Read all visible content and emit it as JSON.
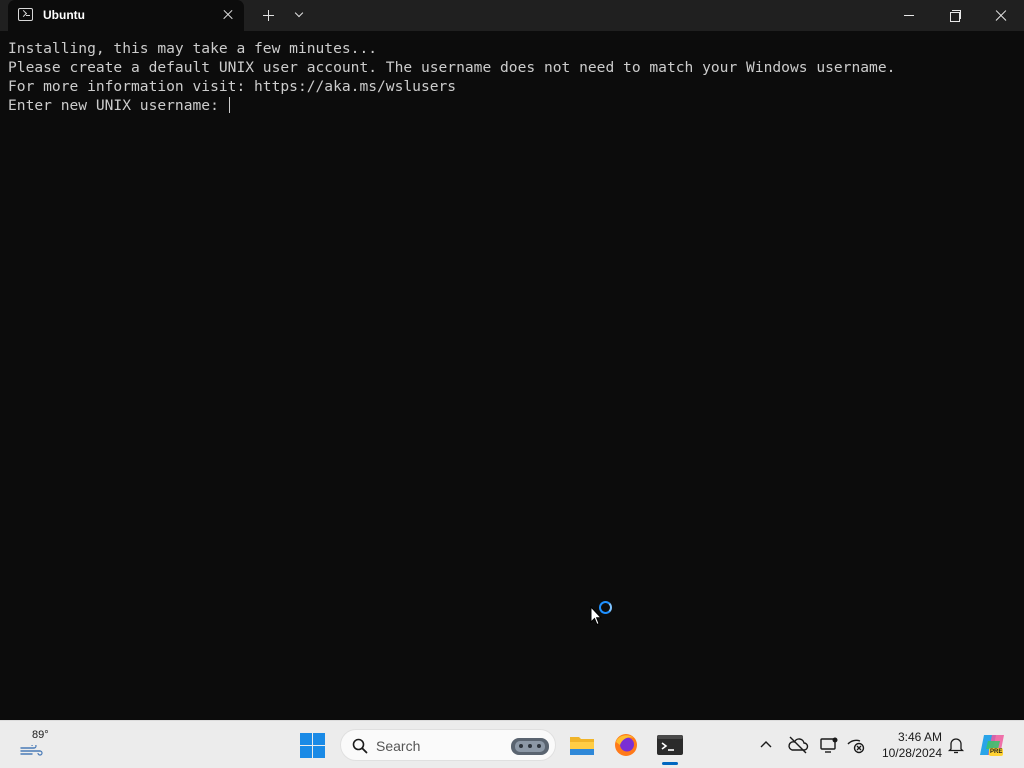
{
  "window": {
    "tab_title": "Ubuntu"
  },
  "terminal": {
    "lines": [
      "Installing, this may take a few minutes...",
      "Please create a default UNIX user account. The username does not need to match your Windows username.",
      "For more information visit: https://aka.ms/wslusers",
      "Enter new UNIX username: "
    ]
  },
  "taskbar": {
    "weather_temp": "89°",
    "search_label": "Search",
    "pinned_apps": [
      "file-explorer",
      "firefox",
      "terminal"
    ],
    "active_app": "terminal",
    "clock_time": "3:46 AM",
    "clock_date": "10/28/2024",
    "copilot_badge": "PRE"
  },
  "colors": {
    "terminal_bg": "#0c0c0c",
    "terminal_fg": "#cccccc",
    "titlebar_bg": "#202020",
    "taskbar_bg": "#ececec",
    "accent": "#0067c0"
  }
}
